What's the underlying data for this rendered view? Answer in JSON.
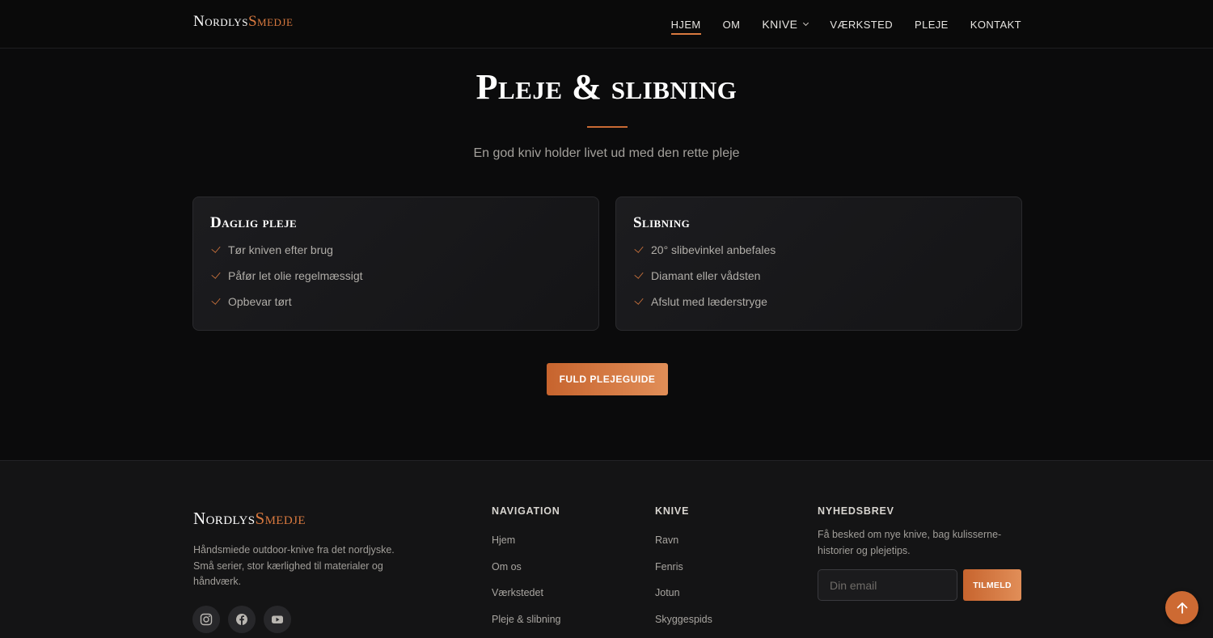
{
  "header": {
    "logo_main": "Nordlys",
    "logo_accent": "Smedje",
    "nav": {
      "home": "HJEM",
      "about": "OM",
      "knives": "KNIVE",
      "workshop": "VÆRKSTED",
      "care": "PLEJE",
      "contact": "KONTAKT"
    }
  },
  "section": {
    "title": "Pleje & slibning",
    "subtitle": "En god kniv holder livet ud med den rette pleje",
    "cards": [
      {
        "title": "Daglig pleje",
        "items": [
          "Tør kniven efter brug",
          "Påfør let olie regelmæssigt",
          "Opbevar tørt"
        ]
      },
      {
        "title": "Slibning",
        "items": [
          "20° slibevinkel anbefales",
          "Diamant eller vådsten",
          "Afslut med læderstryge"
        ]
      }
    ],
    "cta": "FULD PLEJEGUIDE"
  },
  "footer": {
    "logo_main": "Nordlys",
    "logo_accent": "Smedje",
    "description": "Håndsmiede outdoor-knive fra det nordjyske. Små serier, stor kærlighed til materialer og håndværk.",
    "social_icons": [
      "instagram-icon",
      "facebook-icon",
      "youtube-icon"
    ],
    "navigation": {
      "title": "NAVIGATION",
      "links": [
        "Hjem",
        "Om os",
        "Værkstedet",
        "Pleje & slibning"
      ]
    },
    "knives": {
      "title": "KNIVE",
      "links": [
        "Ravn",
        "Fenris",
        "Jotun",
        "Skyggespids"
      ]
    },
    "newsletter": {
      "title": "NYHEDSBREV",
      "text": "Få besked om nye knive, bag kulisserne-historier og plejetips.",
      "placeholder": "Din email",
      "button": "TILMELD"
    }
  },
  "colors": {
    "accent": "#d9793f",
    "background": "#0b0b0c",
    "footer_bg": "#141415"
  }
}
